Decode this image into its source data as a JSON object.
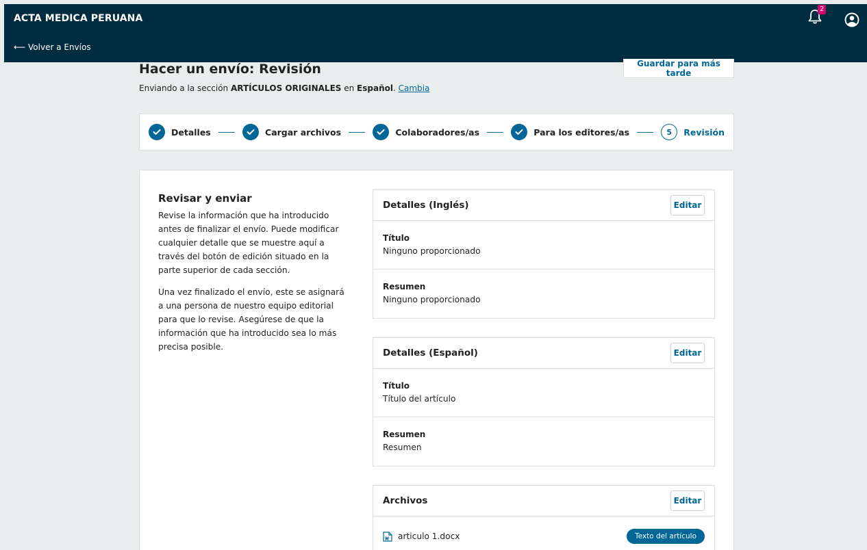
{
  "header": {
    "brand": "ACTA MEDICA PERUANA",
    "back_link": "⟵ Volver a Envíos",
    "notification_count": "2"
  },
  "page": {
    "title": "Hacer un envío: Revisión",
    "save_label": "Guardar para más tarde",
    "subtitle_prefix": "Enviando a la sección ",
    "section_name": "ARTÍCULOS ORIGINALES",
    "subtitle_mid": " en ",
    "language": "Español",
    "subtitle_dot": ". ",
    "change_link": "Cambia"
  },
  "steps": [
    {
      "label": "Detalles",
      "state": "done"
    },
    {
      "label": "Cargar archivos",
      "state": "done"
    },
    {
      "label": "Colaboradores/as",
      "state": "done"
    },
    {
      "label": "Para los editores/as",
      "state": "done"
    },
    {
      "label": "Revisión",
      "state": "current",
      "number": "5"
    }
  ],
  "intro": {
    "heading": "Revisar y enviar",
    "p1": "Revise la información que ha introducido antes de finalizar el envío. Puede modificar cualquier detalle que se muestre aquí a través del botón de edición situado en la parte superior de cada sección.",
    "p2": "Una vez finalizado el envío, este se asignará a una persona de nuestro equipo editorial para que lo revise. Asegúrese de que la información que ha introducido sea lo más precisa posible."
  },
  "panels": {
    "en": {
      "title": "Detalles (Inglés)",
      "edit": "Editar",
      "title_label": "Título",
      "title_value": "Ninguno proporcionado",
      "abstract_label": "Resumen",
      "abstract_value": "Ninguno proporcionado"
    },
    "es": {
      "title": "Detalles (Español)",
      "edit": "Editar",
      "title_label": "Título",
      "title_value": "Título del artículo",
      "abstract_label": "Resumen",
      "abstract_value": "Resumen"
    },
    "files": {
      "title": "Archivos",
      "edit": "Editar",
      "file_name": "articulo 1.docx",
      "file_type": "Texto del artículo"
    }
  },
  "colors": {
    "topbar": "#002c40",
    "accent": "#006798",
    "badge": "#d00a6c"
  }
}
